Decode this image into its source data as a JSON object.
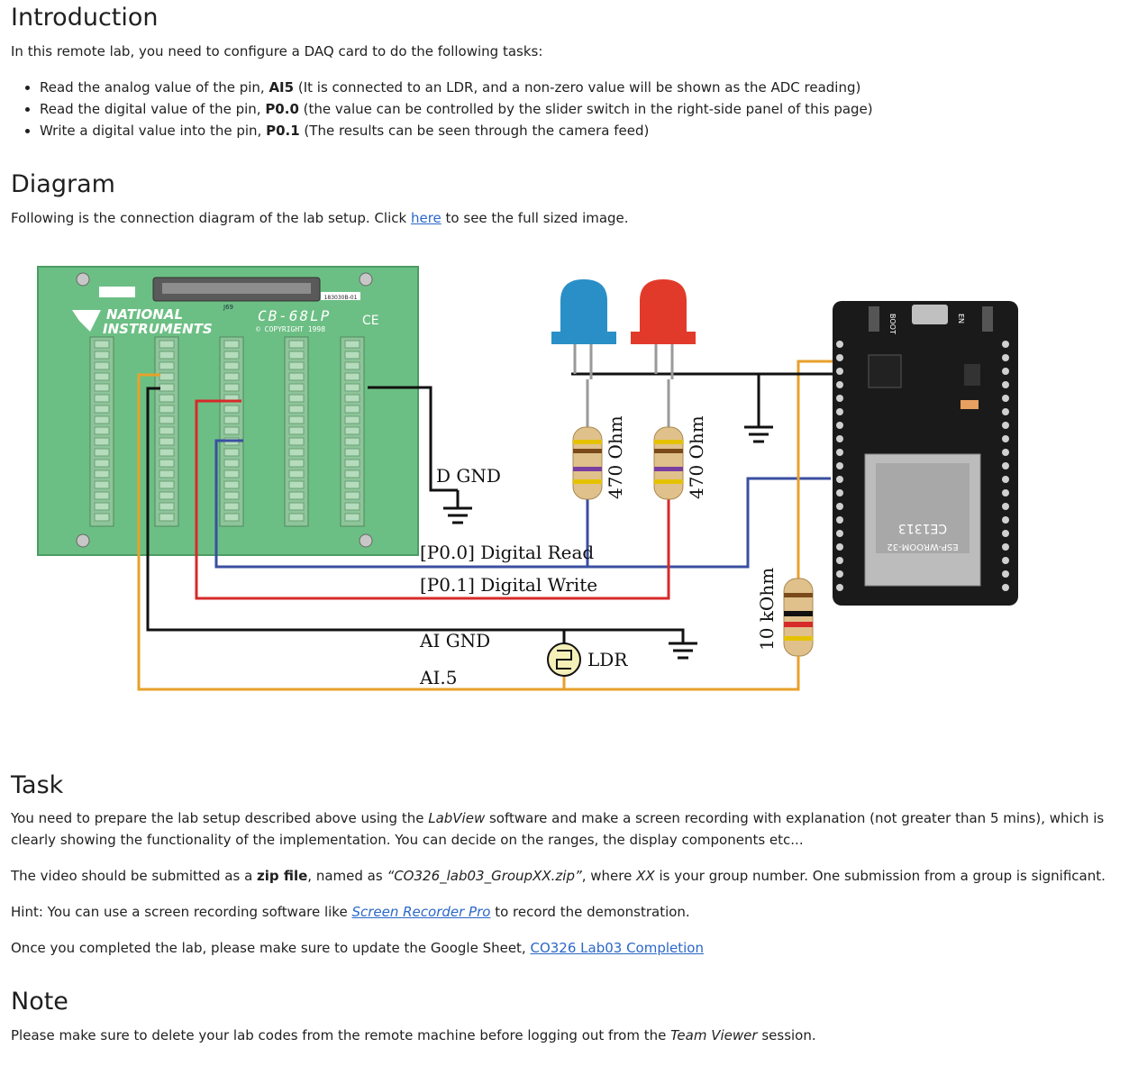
{
  "intro": {
    "heading": "Introduction",
    "lead": "In this remote lab, you need to configure a DAQ card to do the following tasks:",
    "tasks": [
      {
        "pre": "Read the analog value of the pin, ",
        "pin": "AI5",
        "post": " (It is connected to an LDR, and a non-zero value will be shown as the ADC reading)"
      },
      {
        "pre": "Read the digital value of the pin, ",
        "pin": "P0.0",
        "post": " (the value can be controlled by the slider switch in the right-side panel of this page)"
      },
      {
        "pre": "Write a digital value into the pin, ",
        "pin": "P0.1",
        "post": " (The results can be seen through the camera feed)"
      }
    ]
  },
  "diagram": {
    "heading": "Diagram",
    "lead_pre": "Following is the connection diagram of the lab setup. Click ",
    "link": "here",
    "lead_post": " to see the full sized image.",
    "labels": {
      "d_gnd": "D GND",
      "p00": "[P0.0] Digital Read",
      "p01": "[P0.1] Digital Write",
      "ai_gnd": "AI GND",
      "ai5": "AI.5",
      "ldr": "LDR",
      "r1": "470 Ohm",
      "r2": "470 Ohm",
      "r3": "10 kOhm"
    },
    "board": {
      "brand_line1": "NATIONAL",
      "brand_line2": "INSTRUMENTS",
      "model": "CB-68LP",
      "copyright": "© COPYRIGHT 1998",
      "conn": "J69",
      "serial": "183030B-01"
    },
    "esp": {
      "boot": "BOOT",
      "en": "EN",
      "module": "ESP-WROOM-32",
      "ce": "CE1313"
    },
    "colors": {
      "green_board": "#6cbf84",
      "black_wire": "#111111",
      "blue_wire": "#3a4fa0",
      "red_wire": "#d72a2a",
      "orange_wire": "#e8a02b",
      "led_blue": "#2a8fc6",
      "led_red": "#e23a2a"
    }
  },
  "task": {
    "heading": "Task",
    "p1_pre": "You need to prepare the lab setup described above using the ",
    "p1_em": "LabView",
    "p1_post": " software and make a screen recording with explanation (not greater than 5 mins), which is clearly showing the functionality of the implementation. You can decide on the ranges, the display components etc...",
    "p2_pre": "The video should be submitted as a ",
    "p2_b": "zip file",
    "p2_mid": ", named as ",
    "p2_em": "“CO326_lab03_GroupXX.zip”",
    "p2_mid2": ", where ",
    "p2_em2": "XX",
    "p2_post": " is your group number. One submission from a group is significant.",
    "p3_pre": "Hint: You can use a screen recording software like ",
    "p3_link": "Screen Recorder Pro",
    "p3_post": " to record the demonstration.",
    "p4_pre": "Once you completed the lab, please make sure to update the Google Sheet, ",
    "p4_link": "CO326 Lab03 Completion"
  },
  "note": {
    "heading": "Note",
    "p_pre": "Please make sure to delete your lab codes from the remote machine before logging out from the ",
    "p_em": "Team Viewer",
    "p_post": " session."
  }
}
